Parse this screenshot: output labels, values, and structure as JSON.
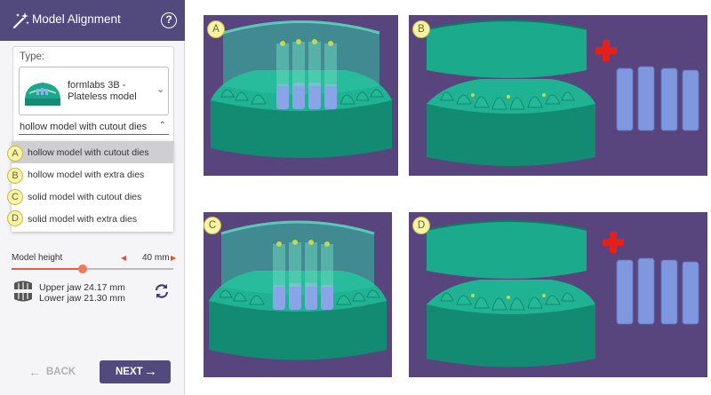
{
  "header": {
    "title": "Model Alignment",
    "help_icon": "?"
  },
  "type_section": {
    "label": "Type:",
    "selected_type": "formlabs 3B - Plateless model",
    "variant_value": "hollow model with cutout dies"
  },
  "dropdown": {
    "options": [
      {
        "badge": "A",
        "label": "hollow model with cutout dies",
        "selected": true
      },
      {
        "badge": "B",
        "label": "hollow model with extra dies",
        "selected": false
      },
      {
        "badge": "C",
        "label": "solid model with cutout dies",
        "selected": false
      },
      {
        "badge": "D",
        "label": "solid model with extra dies",
        "selected": false
      }
    ]
  },
  "model_height": {
    "label": "Model height",
    "value": "40 mm",
    "slider_fraction": 0.44
  },
  "jaw": {
    "upper": "Upper jaw 24.17 mm",
    "lower": "Lower jaw 21.30 mm"
  },
  "nav": {
    "back_label": "BACK",
    "next_label": "NEXT"
  },
  "previews": [
    {
      "badge": "A"
    },
    {
      "badge": "B"
    },
    {
      "badge": "C"
    },
    {
      "badge": "D"
    }
  ],
  "colors": {
    "accent": "#524a7d",
    "model": "#1fa58a",
    "dies": "#7a8fd8",
    "plus": "#e3201b",
    "viewport_bg": "#58457e"
  }
}
